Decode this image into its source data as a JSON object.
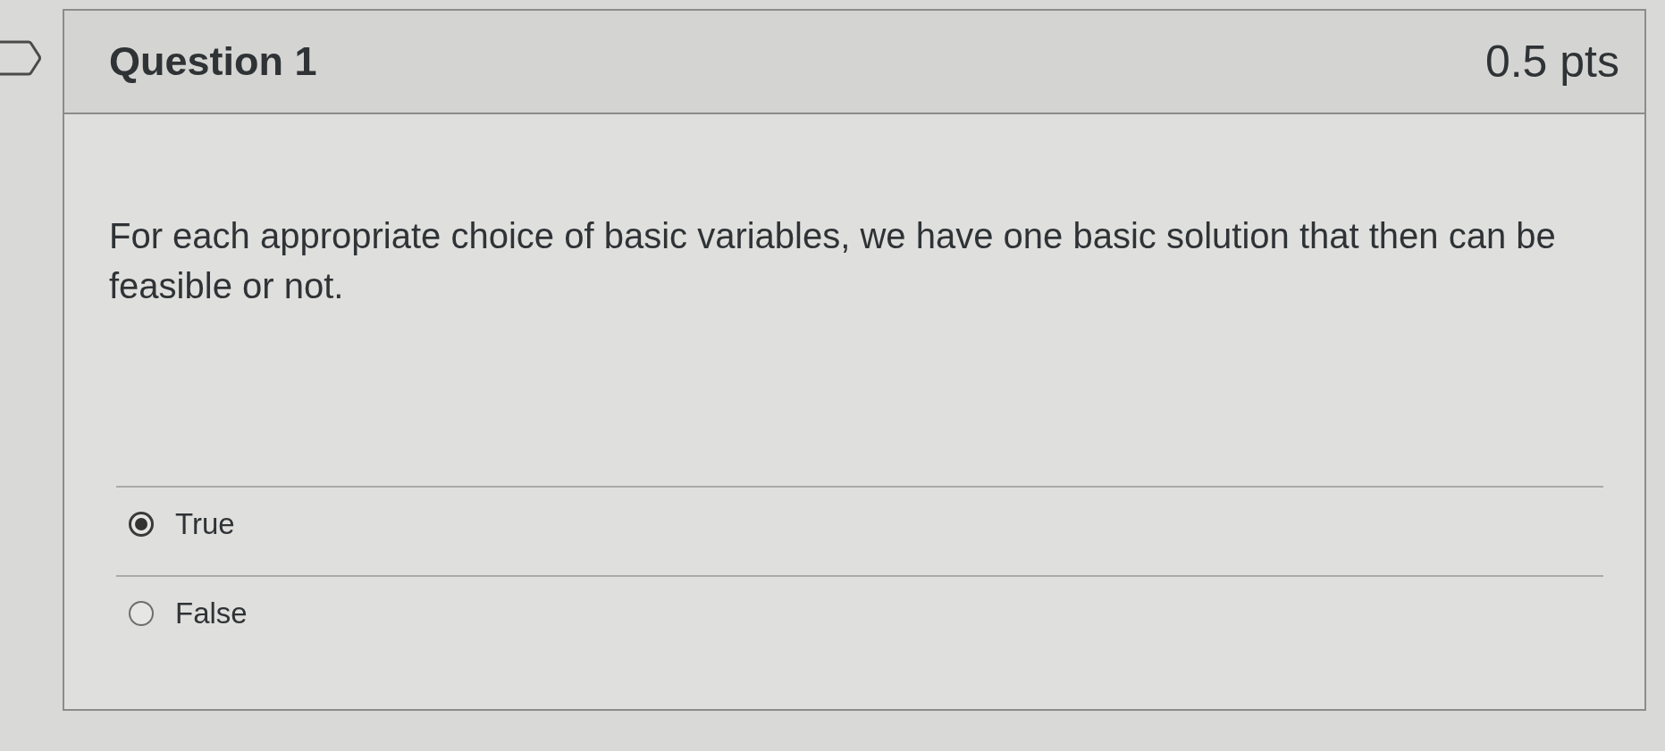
{
  "question": {
    "title": "Question 1",
    "points": "0.5 pts",
    "text": "For each appropriate choice of basic variables, we have one basic solution that then can be feasible or not.",
    "answers": [
      {
        "label": "True",
        "selected": true
      },
      {
        "label": "False",
        "selected": false
      }
    ]
  }
}
